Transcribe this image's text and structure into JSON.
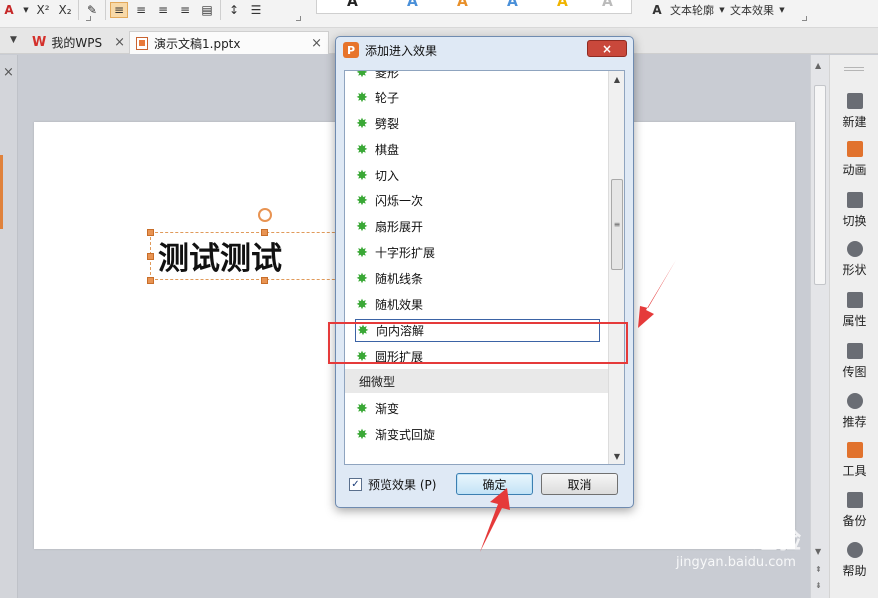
{
  "ribbon": {
    "font_color_icon": "A",
    "superscript_icon": "X²",
    "subscript_icon": "X₂",
    "text_outline_label": "文本轮廓",
    "text_effect_label": "文本效果"
  },
  "tabs": [
    {
      "label": "我的WPS",
      "logo": "W",
      "close": "×"
    },
    {
      "label": "演示文稿1.pptx",
      "close": "×"
    }
  ],
  "tab_menu_icon": "▼",
  "slide": {
    "text": "测试测试"
  },
  "right_panel": {
    "items": [
      {
        "label": "新建",
        "icon": "new-icon"
      },
      {
        "label": "动画",
        "icon": "animation-icon"
      },
      {
        "label": "切换",
        "icon": "transition-icon"
      },
      {
        "label": "形状",
        "icon": "shape-icon"
      },
      {
        "label": "属性",
        "icon": "properties-icon"
      },
      {
        "label": "传图",
        "icon": "upload-image-icon"
      },
      {
        "label": "推荐",
        "icon": "recommend-icon"
      },
      {
        "label": "工具",
        "icon": "toolbox-icon"
      },
      {
        "label": "备份",
        "icon": "backup-icon"
      },
      {
        "label": "帮助",
        "icon": "help-icon"
      }
    ]
  },
  "dialog": {
    "logo": "P",
    "title": "添加进入效果",
    "close": "×",
    "effects": [
      {
        "label": "菱形"
      },
      {
        "label": "轮子"
      },
      {
        "label": "劈裂"
      },
      {
        "label": "棋盘"
      },
      {
        "label": "切入"
      },
      {
        "label": "闪烁一次"
      },
      {
        "label": "扇形展开"
      },
      {
        "label": "十字形扩展"
      },
      {
        "label": "随机线条"
      },
      {
        "label": "随机效果"
      },
      {
        "label": "向内溶解",
        "selected": true
      },
      {
        "label": "圆形扩展"
      }
    ],
    "group_header": "细微型",
    "subtle_effects": [
      {
        "label": "渐变"
      },
      {
        "label": "渐变式回旋"
      }
    ],
    "preview_checkbox": {
      "label": "预览效果 (P)",
      "checked": true
    },
    "ok_label": "确定",
    "cancel_label": "取消"
  },
  "watermark": {
    "brand": "Baidu经验",
    "url": "jingyan.baidu.com"
  },
  "colors": {
    "accent_orange": "#e0823c",
    "highlight_red": "#e53a3a",
    "effect_star_green": "#3aa836",
    "dialog_blue": "#dfe9f5"
  }
}
